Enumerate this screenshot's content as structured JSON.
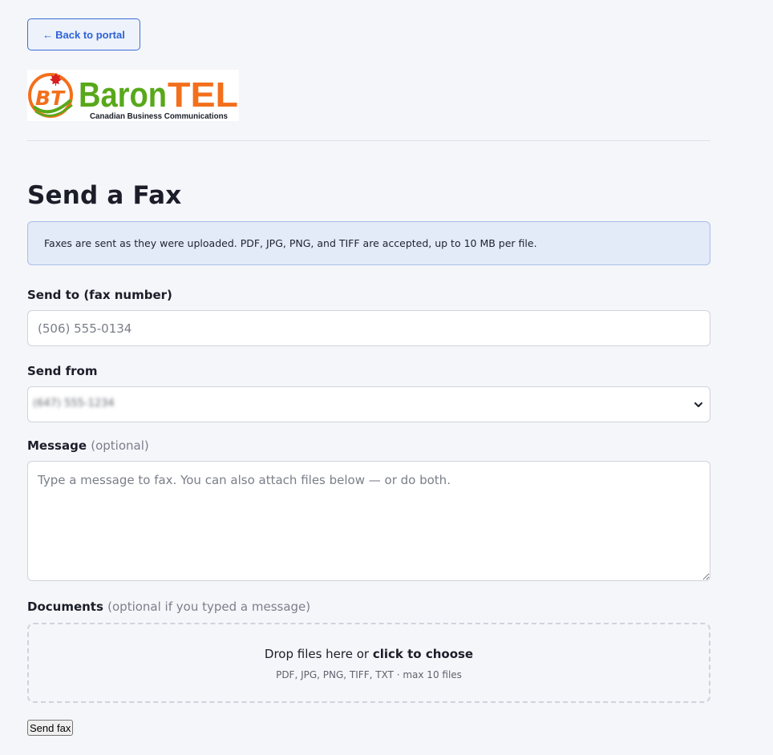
{
  "nav": {
    "back_arrow": "←",
    "back_label": "Back to portal"
  },
  "logo": {
    "badge": "BT",
    "brand_part1": "Baron",
    "brand_part2": "TEL",
    "tagline": "Canadian Business Communications",
    "colors": {
      "green": "#58a81a",
      "orange": "#f36f1c",
      "red": "#d8201f"
    }
  },
  "page": {
    "title": "Send a Fax",
    "notice": "Faxes are sent as they were uploaded. PDF, JPG, PNG, and TIFF are accepted, up to 10 MB per file."
  },
  "form": {
    "send_to": {
      "label": "Send to (fax number)",
      "placeholder": "(506) 555-0134",
      "value": ""
    },
    "send_from": {
      "label": "Send from",
      "selected": "(647) 555-1234"
    },
    "message": {
      "label": "Message",
      "optional": "(optional)",
      "placeholder": "Type a message to fax. You can also attach files below — or do both."
    },
    "documents": {
      "label": "Documents",
      "optional": "(optional if you typed a message)",
      "drop_text": "Drop files here or",
      "drop_link": "click to choose",
      "hint": "PDF, JPG, PNG, TIFF, TXT · max 10 files"
    },
    "submit_label": "Send fax"
  },
  "colors": {
    "accent": "#2d63d6",
    "notice_bg": "#e3eaf8",
    "background": "#f5f6fa"
  }
}
